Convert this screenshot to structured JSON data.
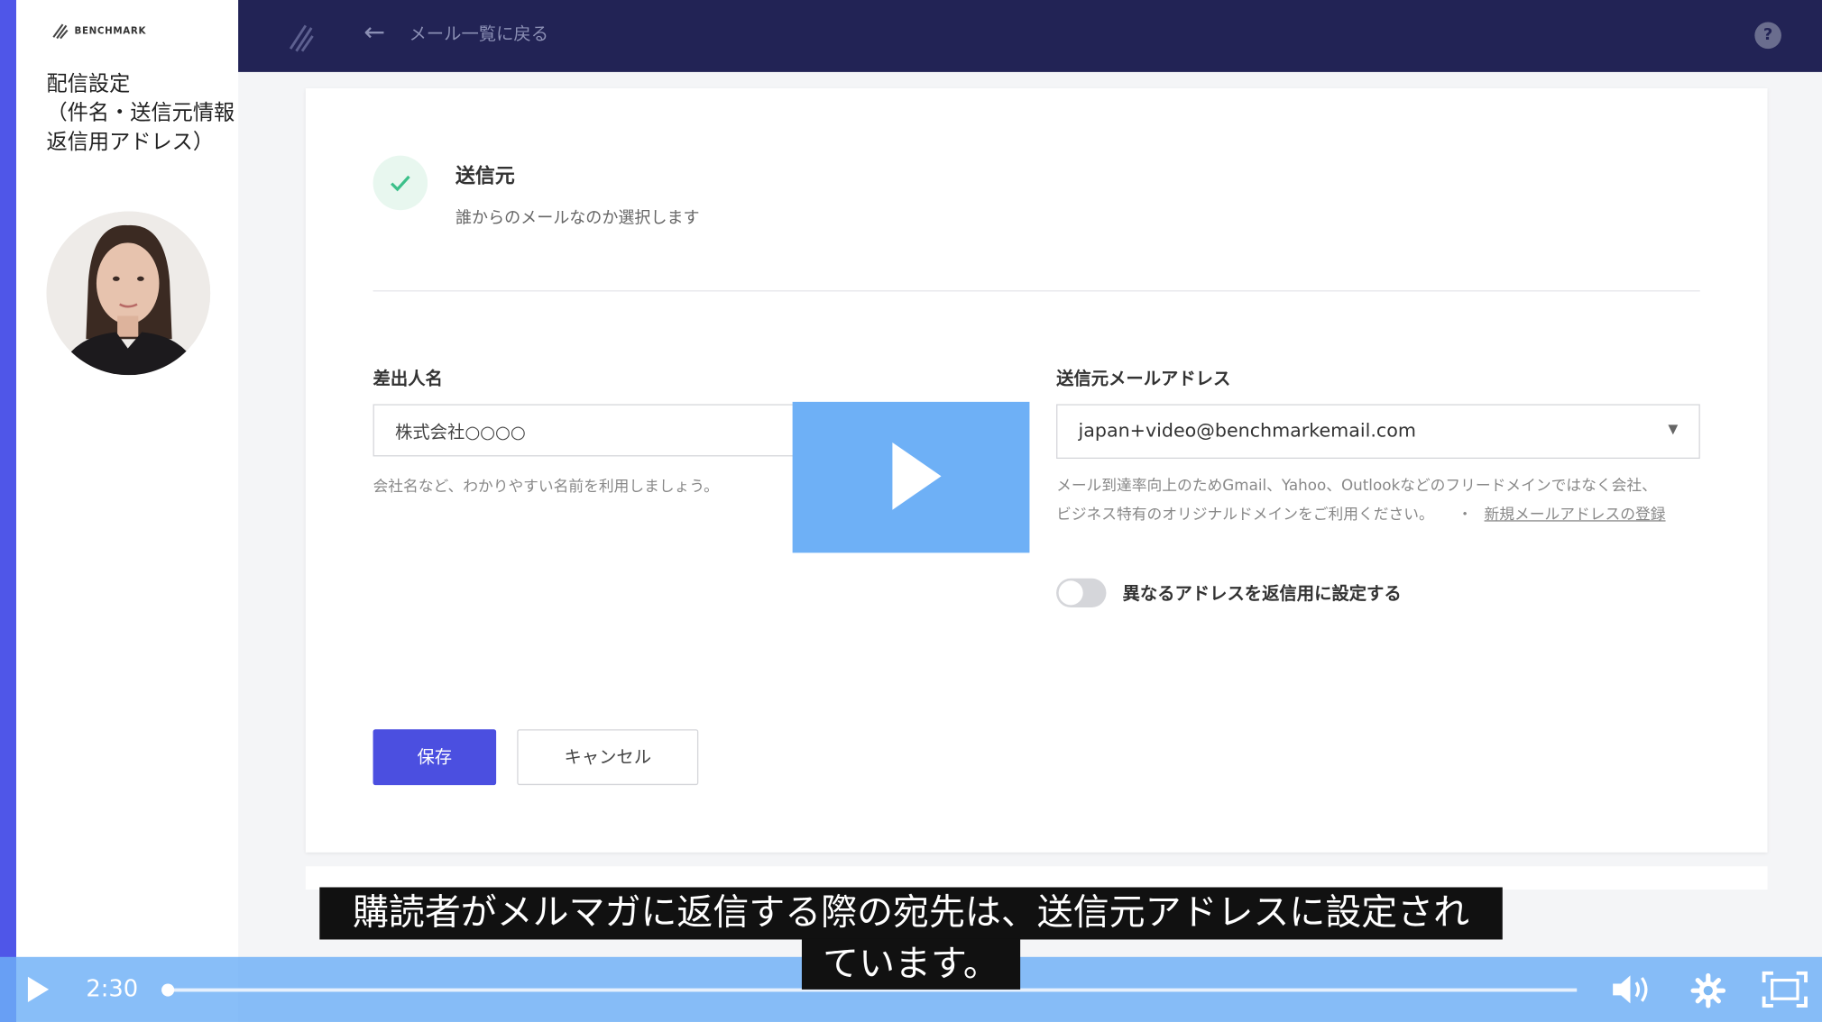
{
  "sidebar": {
    "logo_text": "BENCHMARK",
    "title": "配信設定\n（件名・送信元情報\n返信用アドレス）"
  },
  "topbar": {
    "back_label": "メール一覧に戻る",
    "help_label": "?"
  },
  "section": {
    "title": "送信元",
    "description": "誰からのメールなのか選択します"
  },
  "sender_name": {
    "label": "差出人名",
    "value": "株式会社○○○○",
    "help": "会社名など、わかりやすい名前を利用しましょう。"
  },
  "sender_email": {
    "label": "送信元メールアドレス",
    "value": "japan+video@benchmarkemail.com",
    "help_line1": "メール到達率向上のためGmail、Yahoo、Outlookなどのフリードメインではなく会社、",
    "help_line2": "ビジネス特有のオリジナルドメインをご利用ください。",
    "link_separator": "・",
    "register_link": "新規メールアドレスの登録"
  },
  "reply_toggle": {
    "label": "異なるアドレスを返信用に設定する",
    "enabled": false
  },
  "buttons": {
    "save": "保存",
    "cancel": "キャンセル"
  },
  "subtitles": {
    "line1": "購読者がメルマガに返信する際の宛先は、送信元アドレスに設定され",
    "line2": "ています。"
  },
  "player": {
    "time": "2:30",
    "progress_fraction": 0.001
  },
  "colors": {
    "topbar": "#222355",
    "accent": "#4f56e8",
    "primary_button": "#4b4fe0",
    "player_bar": "#6eb0f6",
    "check_green": "#3cc08a"
  },
  "icons": {
    "play": "play-icon",
    "volume": "volume-icon",
    "settings": "gear-icon",
    "fullscreen": "fullscreen-icon",
    "back": "arrow-left-icon",
    "check": "check-icon"
  }
}
